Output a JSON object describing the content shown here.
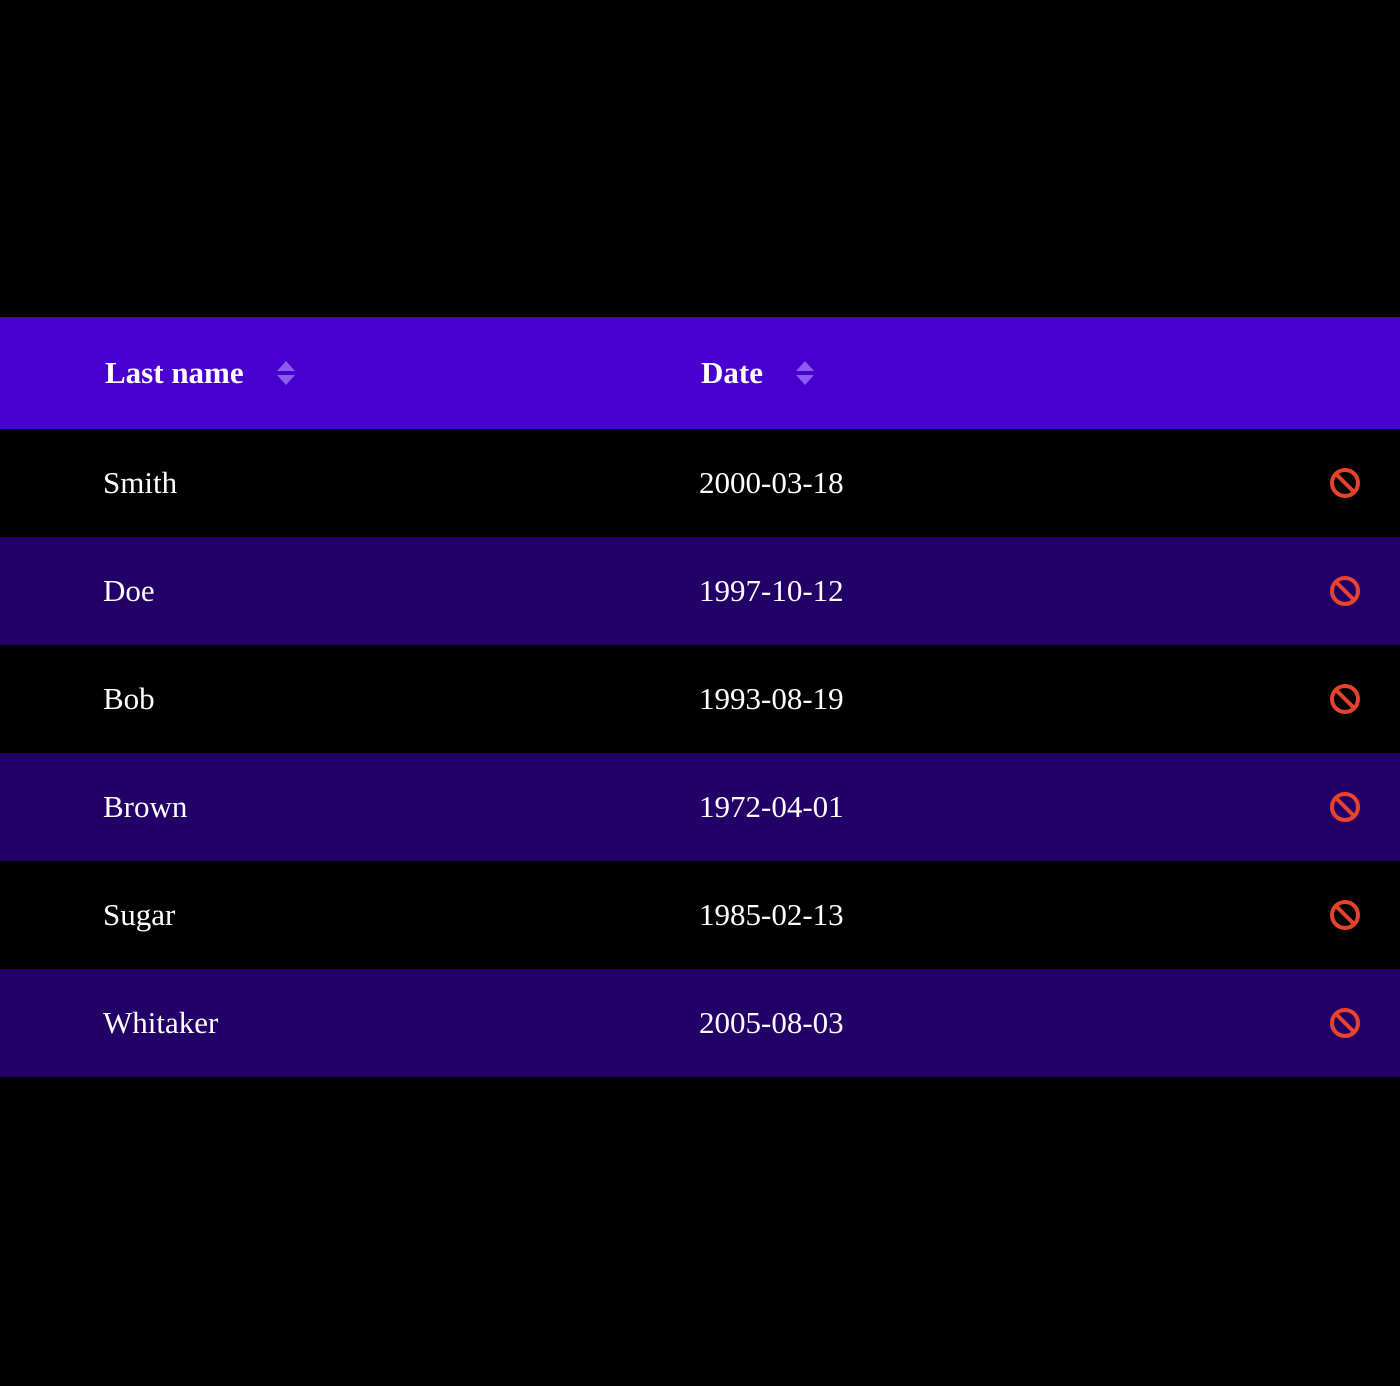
{
  "table": {
    "columns": [
      {
        "label": "Last name",
        "sortable": true
      },
      {
        "label": "Date",
        "sortable": true
      }
    ],
    "rows": [
      {
        "last_name": "Smith",
        "date": "2000-03-18",
        "action_icon": "prohibited-icon"
      },
      {
        "last_name": "Doe",
        "date": "1997-10-12",
        "action_icon": "prohibited-icon"
      },
      {
        "last_name": "Bob",
        "date": "1993-08-19",
        "action_icon": "prohibited-icon"
      },
      {
        "last_name": "Brown",
        "date": "1972-04-01",
        "action_icon": "prohibited-icon"
      },
      {
        "last_name": "Sugar",
        "date": "1985-02-13",
        "action_icon": "prohibited-icon"
      },
      {
        "last_name": "Whitaker",
        "date": "2005-08-03",
        "action_icon": "prohibited-icon"
      }
    ]
  },
  "colors": {
    "header_bg": "#4800cf",
    "row_alt_bg": "#230067",
    "row_bg": "#000000",
    "sort_icon": "#8a5cf0",
    "prohibited_icon": "#e8432f"
  }
}
